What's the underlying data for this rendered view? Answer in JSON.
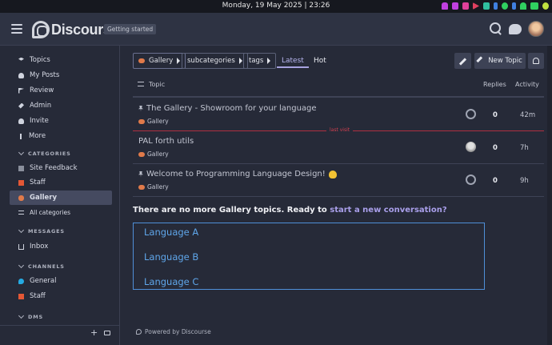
{
  "os_bar": {
    "datetime": "Monday, 19 May 2025 | 23:26"
  },
  "header": {
    "logo_text": "Discourse",
    "badge": "Getting started"
  },
  "sidebar": {
    "items": [
      {
        "label": "Topics",
        "icon": "layers-icon"
      },
      {
        "label": "My Posts",
        "icon": "user-icon"
      },
      {
        "label": "Review",
        "icon": "flag-icon"
      },
      {
        "label": "Admin",
        "icon": "wrench-icon"
      },
      {
        "label": "Invite",
        "icon": "user-plus-icon"
      },
      {
        "label": "More",
        "icon": "ellipsis-icon"
      }
    ],
    "categories_title": "CATEGORIES",
    "categories": [
      {
        "label": "Site Feedback",
        "color": "#8a8f9c"
      },
      {
        "label": "Staff",
        "color": "#e45735"
      },
      {
        "label": "Gallery",
        "color": "#e07a4a"
      }
    ],
    "all_categories": "All categories",
    "messages_title": "MESSAGES",
    "inbox": "Inbox",
    "channels_title": "CHANNELS",
    "channels": [
      {
        "label": "General",
        "color": "#25aae2"
      },
      {
        "label": "Staff",
        "color": "#e45735"
      }
    ],
    "dms_title": "DMS",
    "add_symbol": "+"
  },
  "toolbar": {
    "crumbs": [
      "Gallery",
      "subcategories",
      "tags"
    ],
    "tabs": [
      "Latest",
      "Hot"
    ],
    "new_topic": "New Topic"
  },
  "table": {
    "col_topic": "Topic",
    "col_replies": "Replies",
    "col_activity": "Activity",
    "rows": [
      {
        "title": "The Gallery - Showroom for your language",
        "category": "Gallery",
        "replies": "0",
        "activity": "42m",
        "pinned": true
      },
      {
        "title": "PAL forth utils",
        "category": "Gallery",
        "replies": "0",
        "activity": "7h",
        "pinned": false
      },
      {
        "title": "Welcome to Programming Language Design!",
        "category": "Gallery",
        "replies": "0",
        "activity": "9h",
        "pinned": true
      }
    ],
    "last_visit": "last visit"
  },
  "footer_message": {
    "prefix": "There are no more Gallery topics. Ready to ",
    "link": "start a new conversation?"
  },
  "languages": [
    "Language A",
    "Language B",
    "Language C"
  ],
  "powered_by": "Powered by Discourse",
  "colors": {
    "accent": "#a7a3e0",
    "link": "#5fa6ea",
    "last_visit_line": "#b03040"
  }
}
